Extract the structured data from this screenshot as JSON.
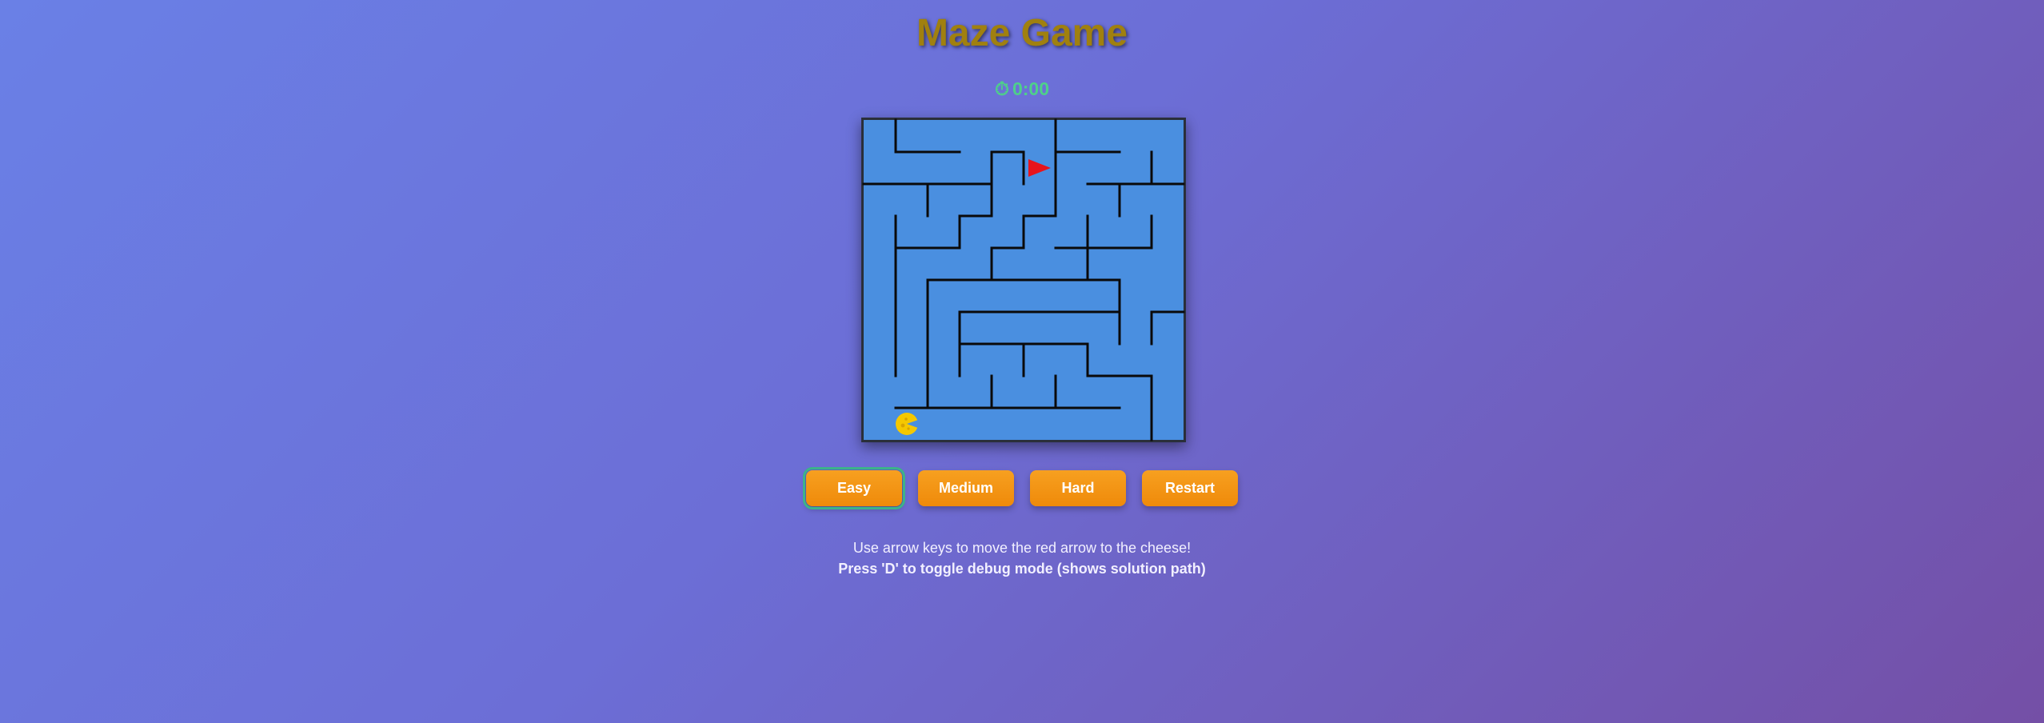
{
  "title": "Maze Game",
  "timer": {
    "icon": "stopwatch-icon",
    "glyph": "⏱",
    "value": "0:00"
  },
  "maze": {
    "grid_size": 10,
    "player": {
      "icon": "red-arrow",
      "row": 1,
      "col": 5,
      "facing": "right",
      "color": "#e8141c"
    },
    "goal": {
      "icon": "cheese-icon",
      "row": 9,
      "col": 1,
      "color": "#f5c800"
    },
    "floor_color": "#4a8fe0",
    "wall_color": "#0a0a0a"
  },
  "buttons": [
    {
      "label": "Easy",
      "active": true
    },
    {
      "label": "Medium",
      "active": false
    },
    {
      "label": "Hard",
      "active": false
    },
    {
      "label": "Restart",
      "active": false
    }
  ],
  "instructions": {
    "line1": "Use arrow keys to move the red arrow to the cheese!",
    "line2": "Press 'D' to toggle debug mode (shows solution path)"
  }
}
